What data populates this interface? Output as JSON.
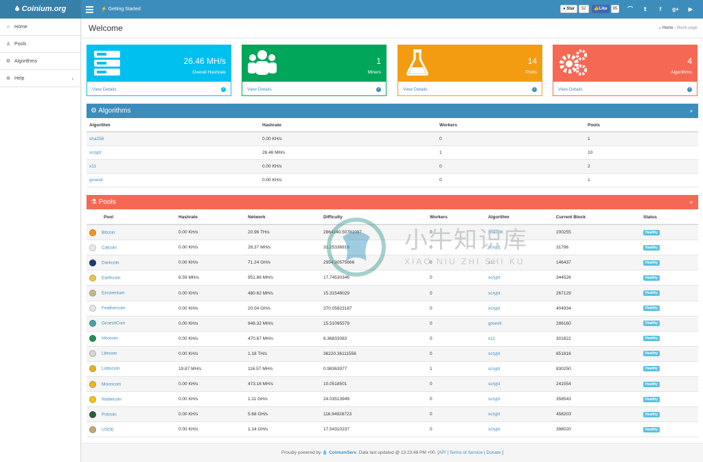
{
  "brand": {
    "name": "Coinium.org"
  },
  "topbar": {
    "getting_started": "Getting Started",
    "github_star": "Star",
    "github_count": "52",
    "fb_like": "Like",
    "fb_count": "95"
  },
  "sidebar": {
    "items": [
      {
        "label": "Home",
        "icon": "home-icon"
      },
      {
        "label": "Pools",
        "icon": "user-icon"
      },
      {
        "label": "Algorithms",
        "icon": "gear-icon"
      },
      {
        "label": "Help",
        "icon": "lifebuoy-icon"
      }
    ]
  },
  "header": {
    "title": "Welcome",
    "breadcrumb_home": "Home",
    "breadcrumb_current": "Blank page"
  },
  "cards": [
    {
      "value": "26.46 MH/s",
      "label": "Overall Hashrate",
      "link": "View Details",
      "color": "#00c0ef",
      "icon": "server-icon"
    },
    {
      "value": "1",
      "label": "Miners",
      "link": "View Details",
      "color": "#00a65a",
      "icon": "users-icon"
    },
    {
      "value": "14",
      "label": "Pools",
      "link": "View Details",
      "color": "#f39c12",
      "icon": "flask-icon"
    },
    {
      "value": "4",
      "label": "Algorithms",
      "link": "View Details",
      "color": "#f56954",
      "icon": "gears-icon"
    }
  ],
  "algorithms": {
    "title": "Algorithms",
    "columns": [
      "Algorithm",
      "Hashrate",
      "Workers",
      "Pools"
    ],
    "rows": [
      [
        "sha256",
        "0.00 KH/s",
        "0",
        "1"
      ],
      [
        "scrypt",
        "26.46 MH/s",
        "1",
        "10"
      ],
      [
        "x11",
        "0.00 KH/s",
        "0",
        "2"
      ],
      [
        "groestl",
        "0.00 KH/s",
        "0",
        "1"
      ]
    ]
  },
  "pools": {
    "title": "Pools",
    "columns": [
      "Pool",
      "Hashrate",
      "Network",
      "Difficulty",
      "Workers",
      "Algorithm",
      "Current Block",
      "Status"
    ],
    "rows": [
      [
        "Bitcoin",
        "0.00 KH/s",
        "20.96 TH/s",
        "2864140.50781097",
        "0",
        "sha256",
        "200255",
        "Healthy"
      ],
      [
        "Catcoin",
        "0.00 KH/s",
        "28.37 MH/s",
        "31.25336916",
        "0",
        "scrypt",
        "31796",
        "Healthy"
      ],
      [
        "Darkcoin",
        "0.00 KH/s",
        "71.24 GH/s",
        "2954.30575666",
        "0",
        "x11",
        "146437",
        "Healthy"
      ],
      [
        "Earthcoin",
        "6.59 MH/s",
        "951.86 MH/s",
        "17.74530346",
        "0",
        "scrypt",
        "344526",
        "Healthy"
      ],
      [
        "Einsteinium",
        "0.00 KH/s",
        "480.62 MH/s",
        "15.31548029",
        "0",
        "scrypt",
        "267129",
        "Healthy"
      ],
      [
        "Feathercoin",
        "0.00 KH/s",
        "20.04 GH/s",
        "370.05823187",
        "0",
        "scrypt",
        "404934",
        "Healthy"
      ],
      [
        "GroestlCoin",
        "0.00 KH/s",
        "948.32 MH/s",
        "15.51095579",
        "0",
        "groestl",
        "286160",
        "Healthy"
      ],
      [
        "Hirocoin",
        "0.00 KH/s",
        "470.67 MH/s",
        "6.36833083",
        "0",
        "x11",
        "301822",
        "Healthy"
      ],
      [
        "Litecoin",
        "0.00 KH/s",
        "1.18 TH/s",
        "36220.36111556",
        "0",
        "scrypt",
        "651816",
        "Healthy"
      ],
      [
        "Lottocoin",
        "19.87 MH/s",
        "116.57 MH/s",
        "0.98363977",
        "1",
        "scrypt",
        "830250",
        "Healthy"
      ],
      [
        "Mooncoin",
        "0.00 KH/s",
        "473.16 MH/s",
        "10.0518501",
        "0",
        "scrypt",
        "241554",
        "Healthy"
      ],
      [
        "Noblecoin",
        "0.00 KH/s",
        "1.11 GH/s",
        "24.03513949",
        "0",
        "scrypt",
        "358543",
        "Healthy"
      ],
      [
        "Potcoin",
        "0.00 KH/s",
        "5.68 GH/s",
        "116.94928723",
        "0",
        "scrypt",
        "458203",
        "Healthy"
      ],
      [
        "USDE",
        "0.00 KH/s",
        "1.14 GH/s",
        "17.54310237",
        "0",
        "scrypt",
        "398020",
        "Healthy"
      ]
    ],
    "coin_colors": [
      "#f7931a",
      "#e8e8e8",
      "#1c3f6e",
      "#e8c84a",
      "#c9b98a",
      "#e5e5e5",
      "#4aa3a0",
      "#2e8b57",
      "#d5d5d5",
      "#e6b325",
      "#e8b820",
      "#f0c419",
      "#2e5e3e",
      "#c2a878"
    ]
  },
  "footer": {
    "prefix": "Proudly powered by",
    "brand": "CoiniumServ",
    "updated": ". Data last updated @ 13:23:48 PM +00. [",
    "api": "API",
    "sep1": "|",
    "terms": "Terms of Service",
    "sep2": "|",
    "donate": "Donate",
    "suffix": "]"
  },
  "watermark": {
    "text": "小牛知识库",
    "sub": "XIAO NIU ZHI SHI KU"
  }
}
